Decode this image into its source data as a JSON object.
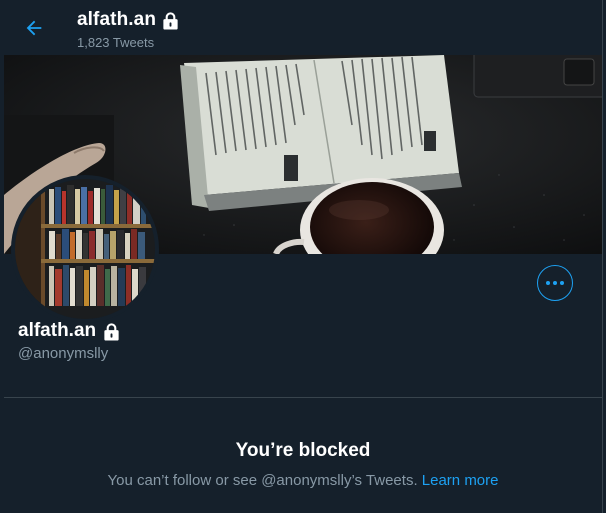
{
  "header": {
    "back_icon": "arrow-left-icon",
    "name": "alfath.an",
    "lock_icon": "lock-icon",
    "tweet_count": "1,823 Tweets"
  },
  "banner": {
    "image": "open book with coffee cup on dark table"
  },
  "avatar": {
    "image": "bookshelf"
  },
  "more_icon": "more-horizontal-icon",
  "profile": {
    "name": "alfath.an",
    "handle": "@anonymslly"
  },
  "blocked": {
    "title": "You’re blocked",
    "message": "You can’t follow or see @anonymslly’s Tweets.",
    "link": "Learn more"
  },
  "colors": {
    "background": "#15202b",
    "accent": "#1da1f2",
    "secondary_text": "#8899a6",
    "border": "#38444d"
  }
}
